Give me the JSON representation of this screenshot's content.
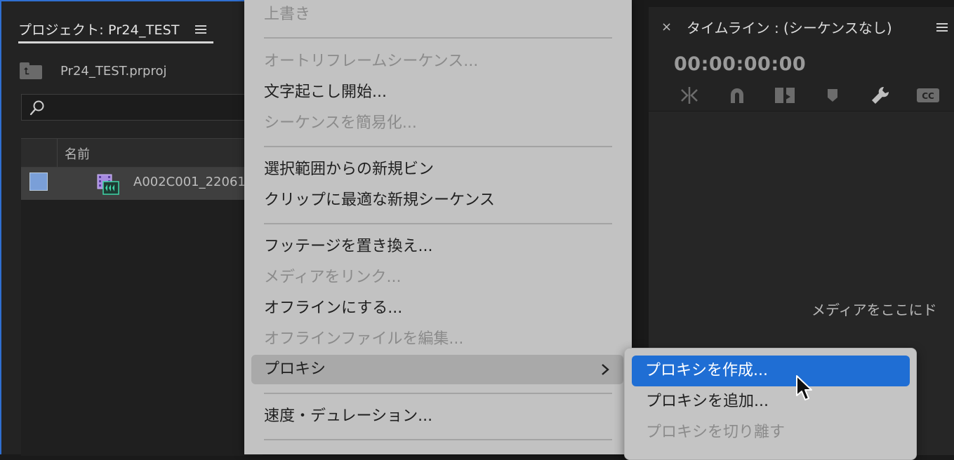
{
  "project": {
    "tab_title": "プロジェクト: Pr24_TEST",
    "file_name": "Pr24_TEST.prproj",
    "search_placeholder": "",
    "column_name": "名前",
    "clip_name": "A002C001_22061",
    "label_color": "#7a9fd8"
  },
  "timeline": {
    "close": "×",
    "title": "タイムライン : (シーケンスなし)",
    "timecode": "00:00:00:00",
    "tool_icons": [
      "snap-insert-icon",
      "magnet-snap-icon",
      "linked-selection-icon",
      "marker-icon",
      "wrench-settings-icon",
      "captions-icon"
    ],
    "captions_label": "CC",
    "drop_hint": "メディアをここにド"
  },
  "context_menu": {
    "overwrite": "上書き",
    "auto_reframe": "オートリフレームシーケンス...",
    "start_transcription": "文字起こし開始...",
    "simplify_sequence": "シーケンスを簡易化...",
    "new_bin_from_selection": "選択範囲からの新規ビン",
    "new_sequence_from_clip": "クリップに最適な新規シーケンス",
    "replace_footage": "フッテージを置き換え...",
    "link_media": "メディアをリンク...",
    "make_offline": "オフラインにする...",
    "edit_offline_file": "オフラインファイルを編集...",
    "proxy": "プロキシ",
    "speed_duration": "速度・デュレーション..."
  },
  "proxy_submenu": {
    "create_proxies": "プロキシを作成...",
    "attach_proxies": "プロキシを追加...",
    "detach_proxies": "プロキシを切り離す",
    "highlight_color": "#1f6ed4"
  }
}
